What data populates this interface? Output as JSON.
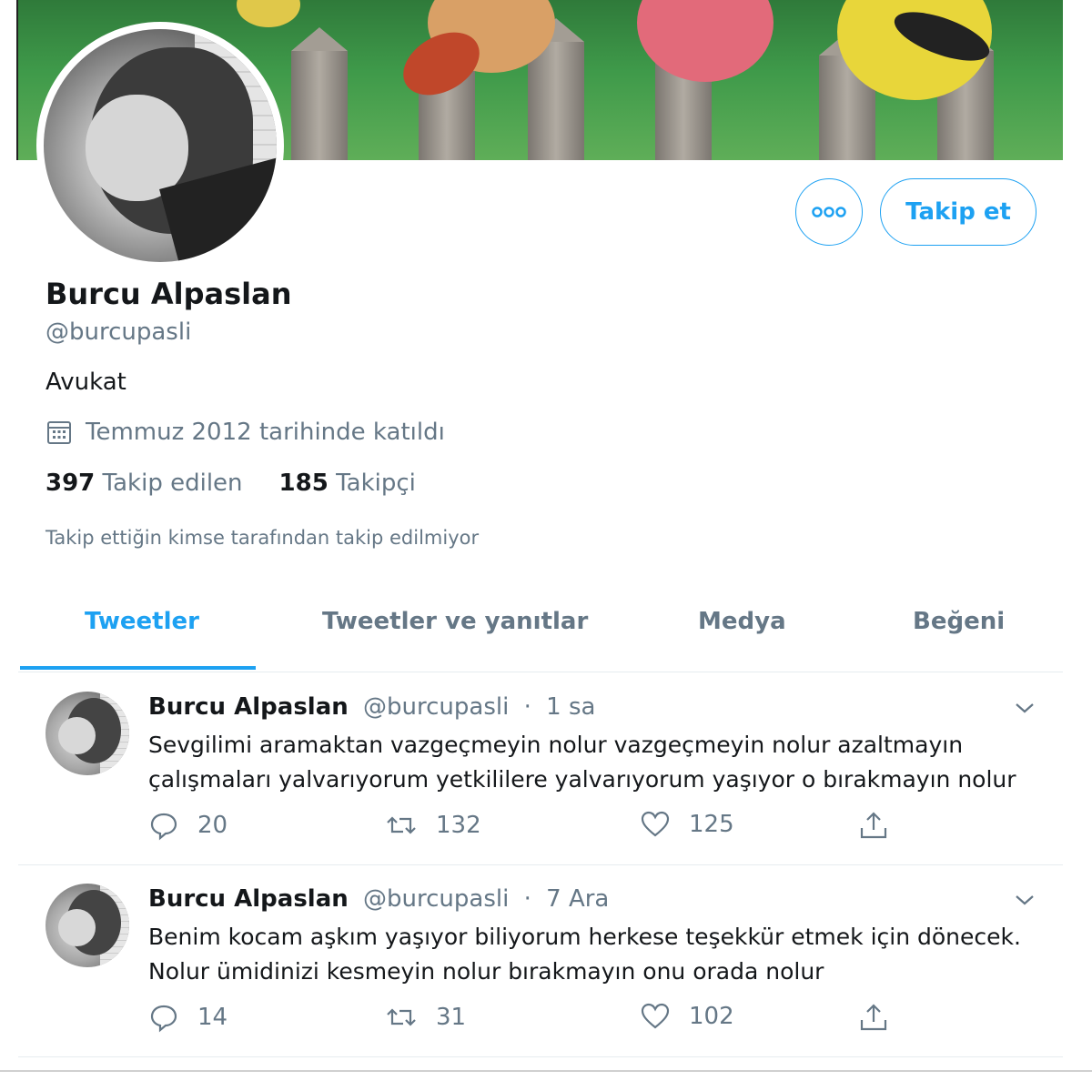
{
  "profile": {
    "name": "Burcu Alpaslan",
    "handle": "@burcupasli",
    "bio": "Avukat",
    "joined": "Temmuz 2012 tarihinde katıldı",
    "following_count": "397",
    "following_label": "Takip edilen",
    "followers_count": "185",
    "followers_label": "Takipçi",
    "no_mutual": "Takip ettiğin kimse tarafından takip edilmiyor"
  },
  "actions": {
    "follow_label": "Takip et",
    "more_icon": "more-icon"
  },
  "tabs": [
    {
      "label": "Tweetler",
      "active": true
    },
    {
      "label": "Tweetler ve yanıtlar",
      "active": false
    },
    {
      "label": "Medya",
      "active": false
    },
    {
      "label": "Beğeni",
      "active": false
    }
  ],
  "tweets": [
    {
      "name": "Burcu Alpaslan",
      "handle": "@burcupasli",
      "sep": "·",
      "time": "1 sa",
      "text": "Sevgilimi aramaktan vazgeçmeyin nolur vazgeçmeyin nolur azaltmayın çalışmaları yalvarıyorum yetkililere yalvarıyorum yaşıyor o bırakmayın nolur",
      "replies": "20",
      "retweets": "132",
      "likes": "125"
    },
    {
      "name": "Burcu Alpaslan",
      "handle": "@burcupasli",
      "sep": "·",
      "time": "7 Ara",
      "text": "Benim kocam aşkım yaşıyor biliyorum herkese teşekkür etmek için dönecek. Nolur ümidinizi kesmeyin nolur bırakmayın onu orada nolur",
      "replies": "14",
      "retweets": "31",
      "likes": "102"
    }
  ],
  "colors": {
    "accent": "#1da1f2",
    "text": "#14171a",
    "muted": "#657786"
  }
}
